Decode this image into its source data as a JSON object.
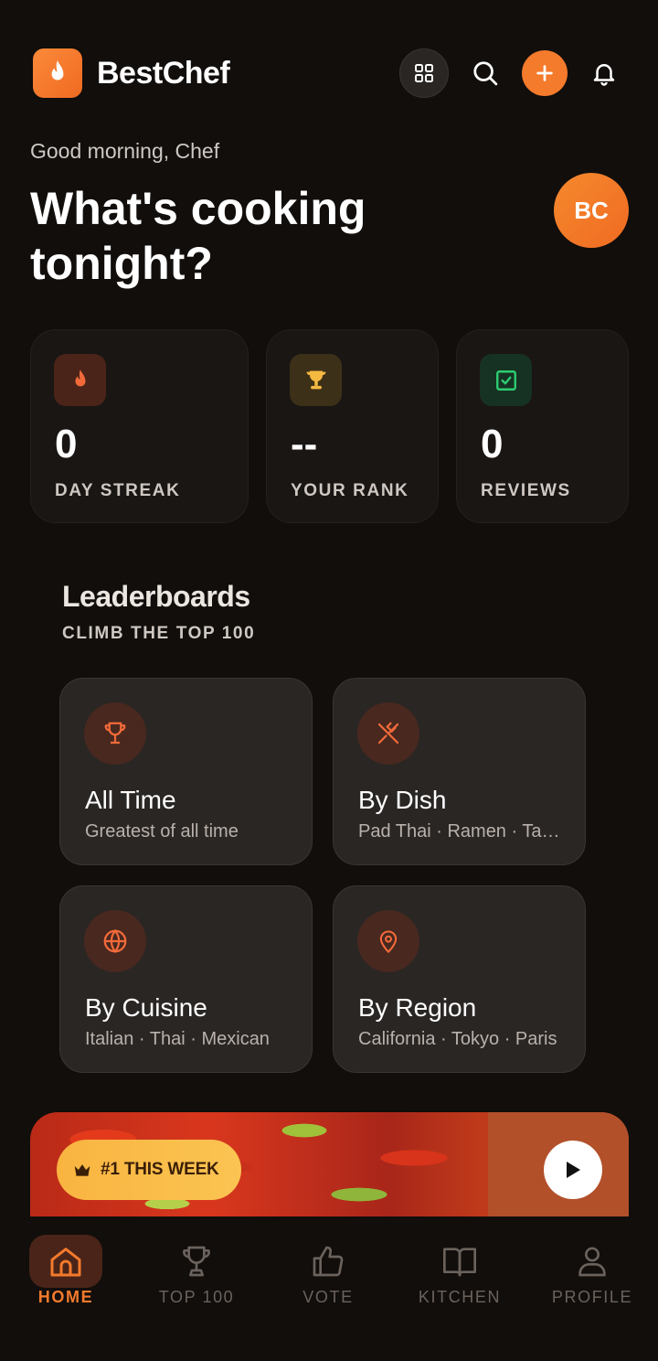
{
  "app": {
    "name": "BestChef"
  },
  "greeting": "Good morning, Chef",
  "headline": "What's cooking tonight?",
  "avatar_initials": "BC",
  "stats": [
    {
      "value": "0",
      "label": "DAY STREAK",
      "icon": "flame-icon"
    },
    {
      "value": "--",
      "label": "YOUR RANK",
      "icon": "trophy-icon"
    },
    {
      "value": "0",
      "label": "REVIEWS",
      "icon": "check-square-icon"
    }
  ],
  "leaderboards": {
    "title": "Leaderboards",
    "subtitle": "CLIMB THE TOP 100",
    "cards": [
      {
        "title": "All Time",
        "subtitle": "Greatest of all time",
        "icon": "trophy-icon"
      },
      {
        "title": "By Dish",
        "subtitle": "Pad Thai · Ramen · Tacos",
        "icon": "utensils-icon"
      },
      {
        "title": "By Cuisine",
        "subtitle": "Italian · Thai · Mexican",
        "icon": "globe-icon"
      },
      {
        "title": "By Region",
        "subtitle": "California · Tokyo · Paris",
        "icon": "map-pin-icon"
      }
    ]
  },
  "banner": {
    "badge": "#1 THIS WEEK"
  },
  "nav": [
    {
      "label": "HOME",
      "icon": "home-icon",
      "active": true
    },
    {
      "label": "TOP 100",
      "icon": "trophy-icon"
    },
    {
      "label": "VOTE",
      "icon": "thumbs-up-icon"
    },
    {
      "label": "KITCHEN",
      "icon": "book-icon"
    },
    {
      "label": "PROFILE",
      "icon": "user-icon"
    }
  ],
  "colors": {
    "accent": "#f47a2c",
    "background": "#110e0c",
    "card": "#2a2624",
    "badge": "#fbc452"
  }
}
